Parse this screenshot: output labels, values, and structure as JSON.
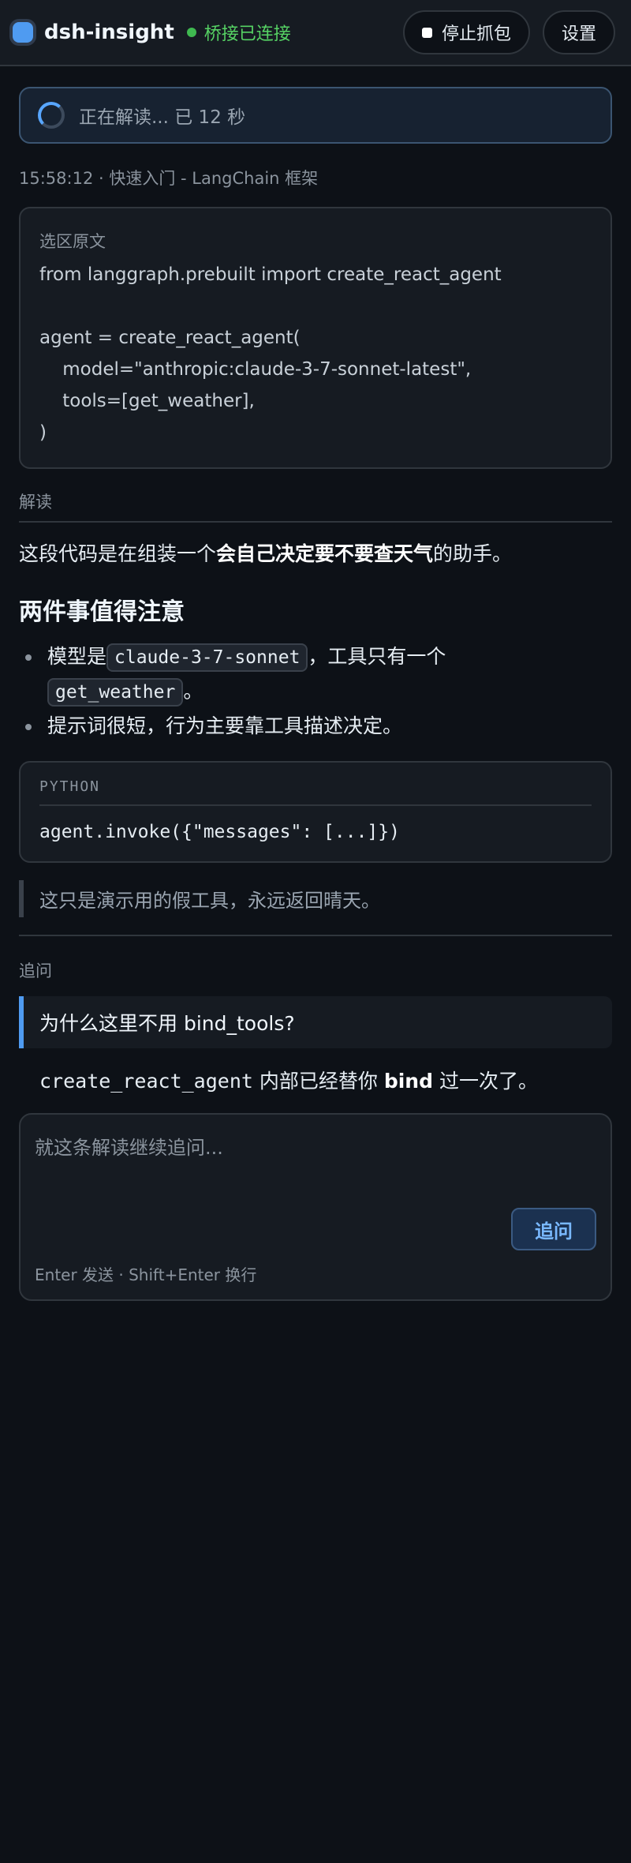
{
  "header": {
    "app_title": "dsh-insight",
    "status_text": "桥接已连接",
    "stop_label": "停止抓包",
    "settings_label": "设置"
  },
  "parse_status": {
    "text": "正在解读... 已 12 秒"
  },
  "meta": {
    "text": "15:58:12 · 快速入门 - LangChain 框架"
  },
  "source": {
    "label": "选区原文",
    "lines": [
      "from langgraph.prebuilt import create_react_agent",
      "",
      "agent = create_react_agent(",
      "    model=\"anthropic:claude-3-7-sonnet-latest\",",
      "    tools=[get_weather],",
      ")"
    ]
  },
  "interpretation": {
    "label": "解读",
    "intro_pre": "这段代码是在组装一个",
    "intro_bold": "会自己决定要不要查天气",
    "intro_post": "的助手。",
    "heading": "两件事值得注意",
    "bullet1_pre": "模型是",
    "bullet1_code1": "claude-3-7-sonnet",
    "bullet1_mid": "，工具只有一个",
    "bullet1_code2": "get_weather",
    "bullet1_post": "。",
    "bullet2": "提示词很短，行为主要靠工具描述决定。",
    "code_lang": "PYTHON",
    "code": "agent.invoke({\"messages\": [...]})",
    "quote": "这只是演示用的假工具，永远返回晴天。"
  },
  "followup": {
    "label": "追问",
    "question": "为什么这里不用 bind_tools?",
    "answer_code": "create_react_agent",
    "answer_mid": " 内部已经替你 ",
    "answer_bold": "bind",
    "answer_post": " 过一次了。"
  },
  "input": {
    "placeholder": "就这条解读继续追问...",
    "send_label": "追问",
    "hint": "Enter 发送 · Shift+Enter 换行"
  },
  "colors": {
    "accent": "#4f9bf1",
    "connected": "#3fb950",
    "background": "#0d1117"
  }
}
